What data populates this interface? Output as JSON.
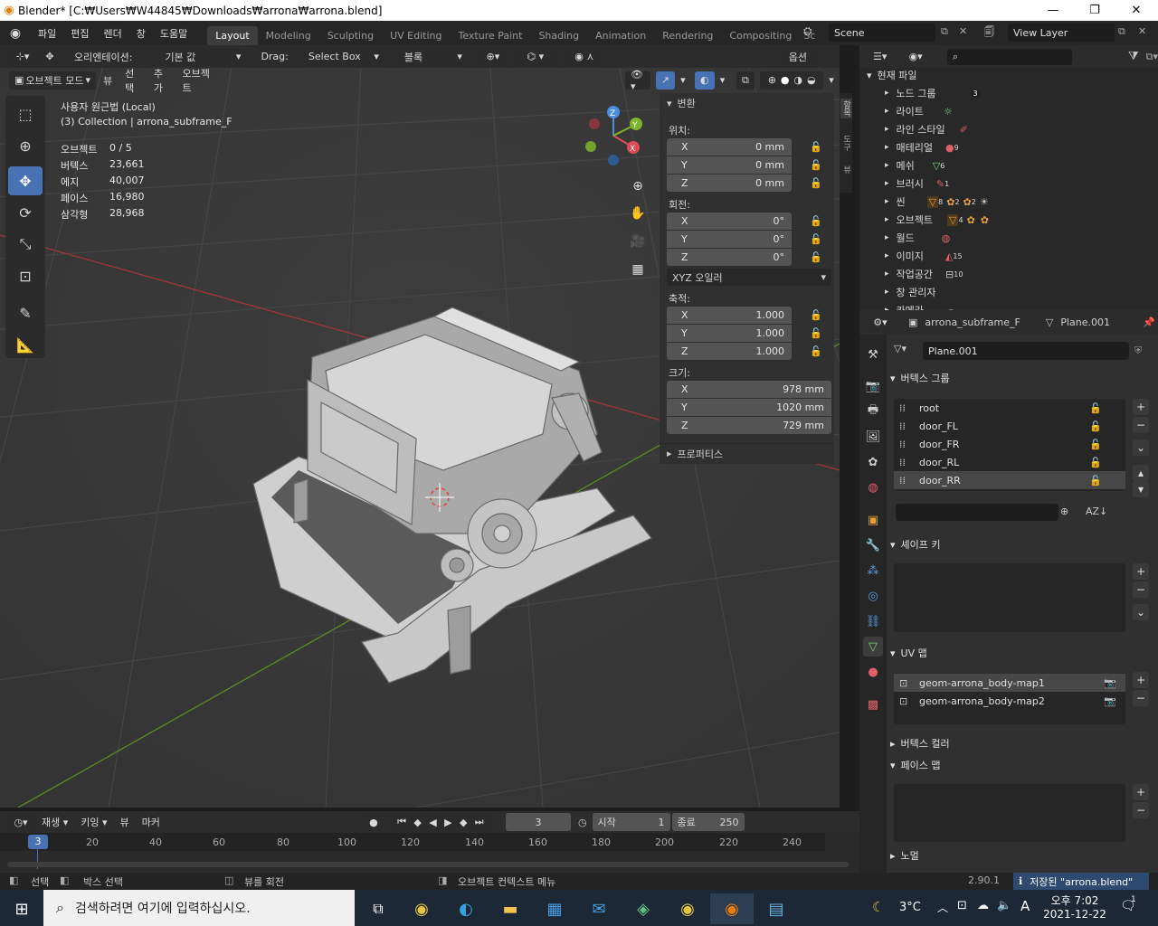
{
  "window": {
    "title": "Blender* [C:₩Users₩W44845₩Downloads₩arrona₩arrona.blend]",
    "minimize": "—",
    "maximize": "❐",
    "close": "✕"
  },
  "menu": [
    "파일",
    "편집",
    "렌더",
    "창",
    "도움말"
  ],
  "workspaces": [
    "Layout",
    "Modeling",
    "Sculpting",
    "UV Editing",
    "Texture Paint",
    "Shading",
    "Animation",
    "Rendering",
    "Compositing",
    "Sc"
  ],
  "scene": {
    "name": "Scene",
    "view_layer": "View Layer"
  },
  "tool_header": {
    "orientation_label": "오리엔테이션:",
    "orientation_value": "기본 값",
    "drag_label": "Drag:",
    "drag_value": "Select Box",
    "pivot_value": "블록",
    "options": "옵션"
  },
  "viewport_header": {
    "mode": "오브젝트 모드",
    "view": "뷰",
    "select": "선택",
    "add": "추가",
    "object": "오브젝트"
  },
  "overlay_info": {
    "view_name": "사용자 원근법 (Local)",
    "collection": "(3) Collection | arrona_subframe_F",
    "stats": [
      {
        "label": "오브젝트",
        "value": "0 / 5"
      },
      {
        "label": "버텍스",
        "value": "23,661"
      },
      {
        "label": "에지",
        "value": "40,007"
      },
      {
        "label": "페이스",
        "value": "16,980"
      },
      {
        "label": "삼각형",
        "value": "28,968"
      }
    ]
  },
  "gizmo": {
    "x": "X",
    "y": "Y",
    "z": "Z"
  },
  "npanel": {
    "transform": "변환",
    "location": "위치:",
    "loc": [
      {
        "axis": "X",
        "value": "0 mm"
      },
      {
        "axis": "Y",
        "value": "0 mm"
      },
      {
        "axis": "Z",
        "value": "0 mm"
      }
    ],
    "rotation": "회전:",
    "rot": [
      {
        "axis": "X",
        "value": "0°"
      },
      {
        "axis": "Y",
        "value": "0°"
      },
      {
        "axis": "Z",
        "value": "0°"
      }
    ],
    "rot_mode": "XYZ 오일러",
    "scale": "축적:",
    "scl": [
      {
        "axis": "X",
        "value": "1.000"
      },
      {
        "axis": "Y",
        "value": "1.000"
      },
      {
        "axis": "Z",
        "value": "1.000"
      }
    ],
    "dimensions": "크기:",
    "dim": [
      {
        "axis": "X",
        "value": "978 mm"
      },
      {
        "axis": "Y",
        "value": "1020 mm"
      },
      {
        "axis": "Z",
        "value": "729 mm"
      }
    ],
    "properties": "프로퍼티스",
    "tabs": [
      "항목",
      "도구",
      "뷰"
    ]
  },
  "outliner": {
    "root": "현재 파일",
    "items": [
      {
        "label": "노드 그룹",
        "badge": "3"
      },
      {
        "label": "라이트",
        "badge": ""
      },
      {
        "label": "라인 스타일",
        "badge": ""
      },
      {
        "label": "매테리얼",
        "badge": "9"
      },
      {
        "label": "메쉬",
        "badge": "6"
      },
      {
        "label": "브러시",
        "badge": "1"
      },
      {
        "label": "씬",
        "badge": "8"
      },
      {
        "label": "오브젝트",
        "badge": "4"
      },
      {
        "label": "월드",
        "badge": ""
      },
      {
        "label": "이미지",
        "badge": "15"
      },
      {
        "label": "작업공간",
        "badge": "10"
      },
      {
        "label": "창 관리자",
        "badge": ""
      },
      {
        "label": "카메라",
        "badge": ""
      }
    ],
    "scene_badges": [
      "2",
      "2"
    ]
  },
  "properties": {
    "object_name": "arrona_subframe_F",
    "mesh_name": "Plane.001",
    "datablock": "Plane.001",
    "vertex_groups": {
      "title": "버텍스 그룹",
      "items": [
        "root",
        "door_FL",
        "door_FR",
        "door_RL",
        "door_RR"
      ]
    },
    "shape_keys": "셰이프 키",
    "uv_maps": {
      "title": "UV 맵",
      "items": [
        "geom-arrona_body-map1",
        "geom-arrona_body-map2"
      ]
    },
    "vertex_colors": "버텍스 컬러",
    "face_maps": "페이스 맵",
    "normals": "노멀"
  },
  "timeline": {
    "playback": "재생",
    "keying": "키잉",
    "view": "뷰",
    "marker": "마커",
    "current_frame": "3",
    "start_label": "시작",
    "start": "1",
    "end_label": "종료",
    "end": "250",
    "ticks": [
      "20",
      "40",
      "60",
      "80",
      "100",
      "120",
      "140",
      "160",
      "180",
      "200",
      "220",
      "240"
    ]
  },
  "statusbar": {
    "select": "선택",
    "box_select": "박스 선택",
    "rotate_view": "뷰를 회전",
    "context_menu": "오브젝트 컨텍스트 메뉴",
    "version": "2.90.1",
    "saved": "저장된 \"arrona.blend\""
  },
  "taskbar": {
    "search_placeholder": "검색하려면 여기에 입력하십시오.",
    "temperature": "3°C",
    "time": "오후 7:02",
    "date": "2021-12-22",
    "ime": "A",
    "notifications": "1"
  }
}
